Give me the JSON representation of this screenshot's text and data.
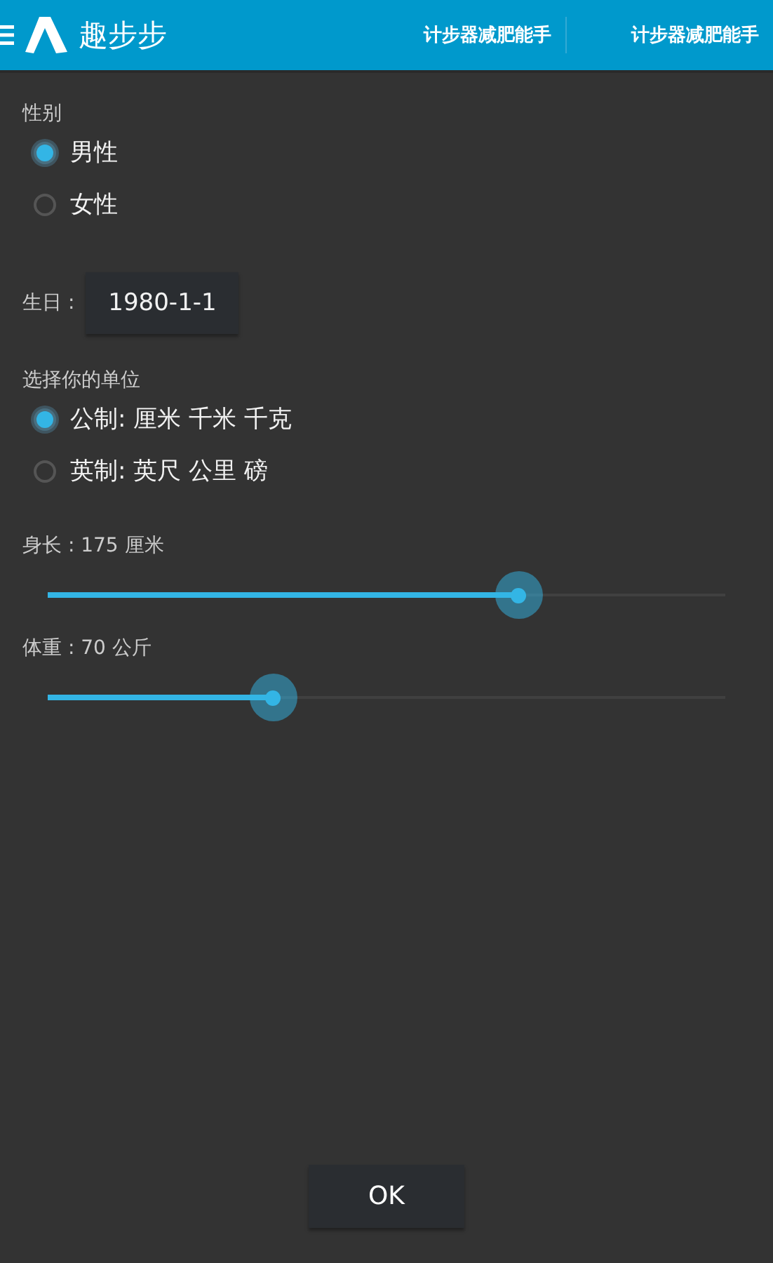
{
  "app_bar": {
    "title": "趣步步",
    "tabs": [
      "计步器减肥能手",
      "计步器减肥能手"
    ]
  },
  "gender": {
    "label": "性别",
    "options": [
      {
        "label": "男性",
        "selected": true
      },
      {
        "label": "女性",
        "selected": false
      }
    ]
  },
  "birthday": {
    "label": "生日 :",
    "value": "1980-1-1"
  },
  "units": {
    "label": "选择你的单位",
    "options": [
      {
        "label": "公制:  厘米 千米 千克",
        "selected": true
      },
      {
        "label": "英制: 英尺 公里 磅",
        "selected": false
      }
    ]
  },
  "sliders": [
    {
      "label": "身长 : 175 厘米",
      "level": 0.695
    },
    {
      "label": "体重 : 70 公斤",
      "level": 0.333
    }
  ],
  "buttons": [
    "OK"
  ]
}
